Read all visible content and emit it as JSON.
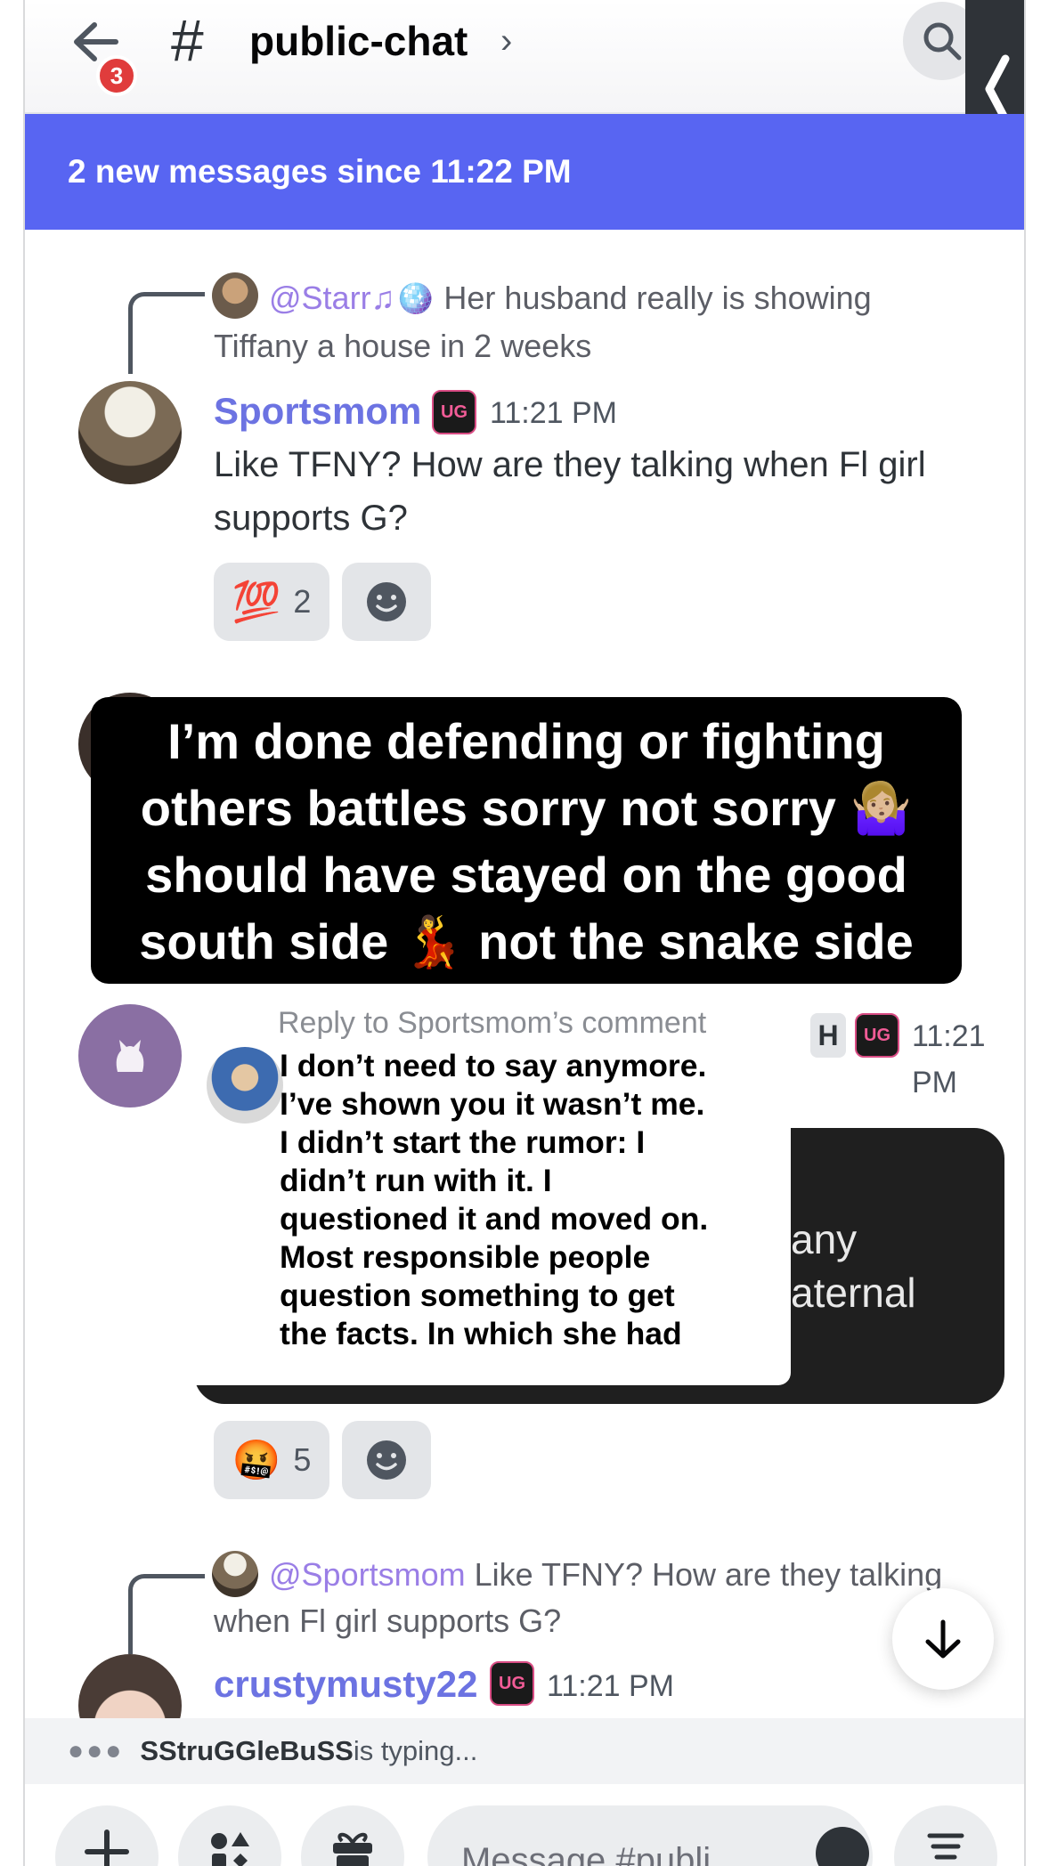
{
  "header": {
    "unread_count": "3",
    "channel_hash": "#",
    "channel_name": "public-chat",
    "chevron": "›",
    "icons": [
      "back-arrow-icon",
      "search-icon",
      "collapse-icon"
    ]
  },
  "banner": {
    "text": "2 new messages since 11:22 PM"
  },
  "messages": [
    {
      "reply_to_user": "@Starr♫🪩",
      "reply_to_snippet": "Her husband really is showing",
      "reply_to_snippet_2": "Tiffany a house in 2 weeks",
      "author": "Sportsmom",
      "time": "11:21 PM",
      "text_line_1": "Like TFNY? How are they talking when Fl girl",
      "text_line_2": "supports G?",
      "reactions": [
        {
          "emoji": "💯",
          "count": "2"
        }
      ]
    },
    {
      "author_partial": "H",
      "time": "11:21 PM",
      "text_partial_1": "any",
      "text_partial_2": "aternal",
      "reactions": [
        {
          "emoji": "🤬",
          "count": "5"
        }
      ]
    },
    {
      "reply_to_user": "@Sportsmom",
      "reply_to_snippet": "Like TFNY? How are they talking",
      "reply_to_snippet_2": "when Fl girl supports G?",
      "author": "crustymusty22",
      "time": "11:21 PM"
    }
  ],
  "caption": {
    "line_1": "I’m done defending or fighting",
    "line_2": "others battles sorry not sorry 🤷🏼‍♀️",
    "line_3": "should have stayed on the good",
    "line_4": "south side 💃 not the snake side"
  },
  "comment_sticker": {
    "heading": "Reply to Sportsmom’s comment",
    "line_1": "I don’t need to say anymore.",
    "line_2": "I’ve shown you it wasn’t me.",
    "line_3": "I didn’t start the rumor: I",
    "line_4": "didn’t run with it. I",
    "line_5": "questioned it and moved on.",
    "line_6": "Most responsible people",
    "line_7": "question something to get",
    "line_8": "the facts. In which she had"
  },
  "typing": {
    "dots": "●●●",
    "user": "SStruGGleBuSS",
    "suffix": " is typing..."
  },
  "composer": {
    "placeholder": "Message #publi..."
  },
  "role_badge_text": "UG",
  "colors": {
    "brand": "#5865f2",
    "username": "#6c73e2",
    "mention": "#9a7ee6",
    "badge_red": "#e03c3c"
  }
}
